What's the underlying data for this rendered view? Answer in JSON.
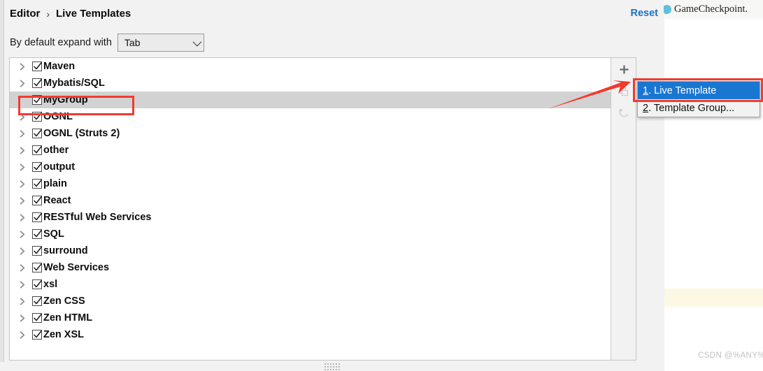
{
  "colors": {
    "accent_link": "#1a72c4",
    "menu_highlight": "#1977d2",
    "annotation_red": "#f03b30",
    "selection_gray": "#d2d2d2",
    "editor_highlight_line": "#fdf8e3"
  },
  "breadcrumb": {
    "root": "Editor",
    "separator": "›",
    "current": "Live Templates"
  },
  "header": {
    "reset_label": "Reset"
  },
  "expand": {
    "label": "By default expand with",
    "selected_value": "Tab",
    "chevron_icon": "chevron-down-icon"
  },
  "tree": {
    "items": [
      {
        "label": "Maven",
        "checked": true,
        "expandable": true,
        "selected": false
      },
      {
        "label": "Mybatis/SQL",
        "checked": true,
        "expandable": true,
        "selected": false
      },
      {
        "label": "MyGroup",
        "checked": true,
        "expandable": false,
        "selected": true
      },
      {
        "label": "OGNL",
        "checked": true,
        "expandable": true,
        "selected": false
      },
      {
        "label": "OGNL (Struts 2)",
        "checked": true,
        "expandable": true,
        "selected": false
      },
      {
        "label": "other",
        "checked": true,
        "expandable": true,
        "selected": false
      },
      {
        "label": "output",
        "checked": true,
        "expandable": true,
        "selected": false
      },
      {
        "label": "plain",
        "checked": true,
        "expandable": true,
        "selected": false
      },
      {
        "label": "React",
        "checked": true,
        "expandable": true,
        "selected": false
      },
      {
        "label": "RESTful Web Services",
        "checked": true,
        "expandable": true,
        "selected": false
      },
      {
        "label": "SQL",
        "checked": true,
        "expandable": true,
        "selected": false
      },
      {
        "label": "surround",
        "checked": true,
        "expandable": true,
        "selected": false
      },
      {
        "label": "Web Services",
        "checked": true,
        "expandable": true,
        "selected": false
      },
      {
        "label": "xsl",
        "checked": true,
        "expandable": true,
        "selected": false
      },
      {
        "label": "Zen CSS",
        "checked": true,
        "expandable": true,
        "selected": false
      },
      {
        "label": "Zen HTML",
        "checked": true,
        "expandable": true,
        "selected": false
      },
      {
        "label": "Zen XSL",
        "checked": true,
        "expandable": true,
        "selected": false
      }
    ]
  },
  "toolbar": {
    "add_icon": "plus-icon",
    "duplicate_icon": "copy-icon",
    "revert_icon": "undo-arrow-icon"
  },
  "add_menu": {
    "items": [
      {
        "mnemonic": "1",
        "text": ". Live Template",
        "highlighted": true
      },
      {
        "mnemonic": "2",
        "text": ". Template Group...",
        "highlighted": false
      }
    ]
  },
  "scrollbar": {
    "orientation": "vertical"
  },
  "background_ide": {
    "tab_label": "GameCheckpoint.",
    "tab_file_icon": "java-file-icon",
    "watermark": "CSDN @%ANY%"
  }
}
